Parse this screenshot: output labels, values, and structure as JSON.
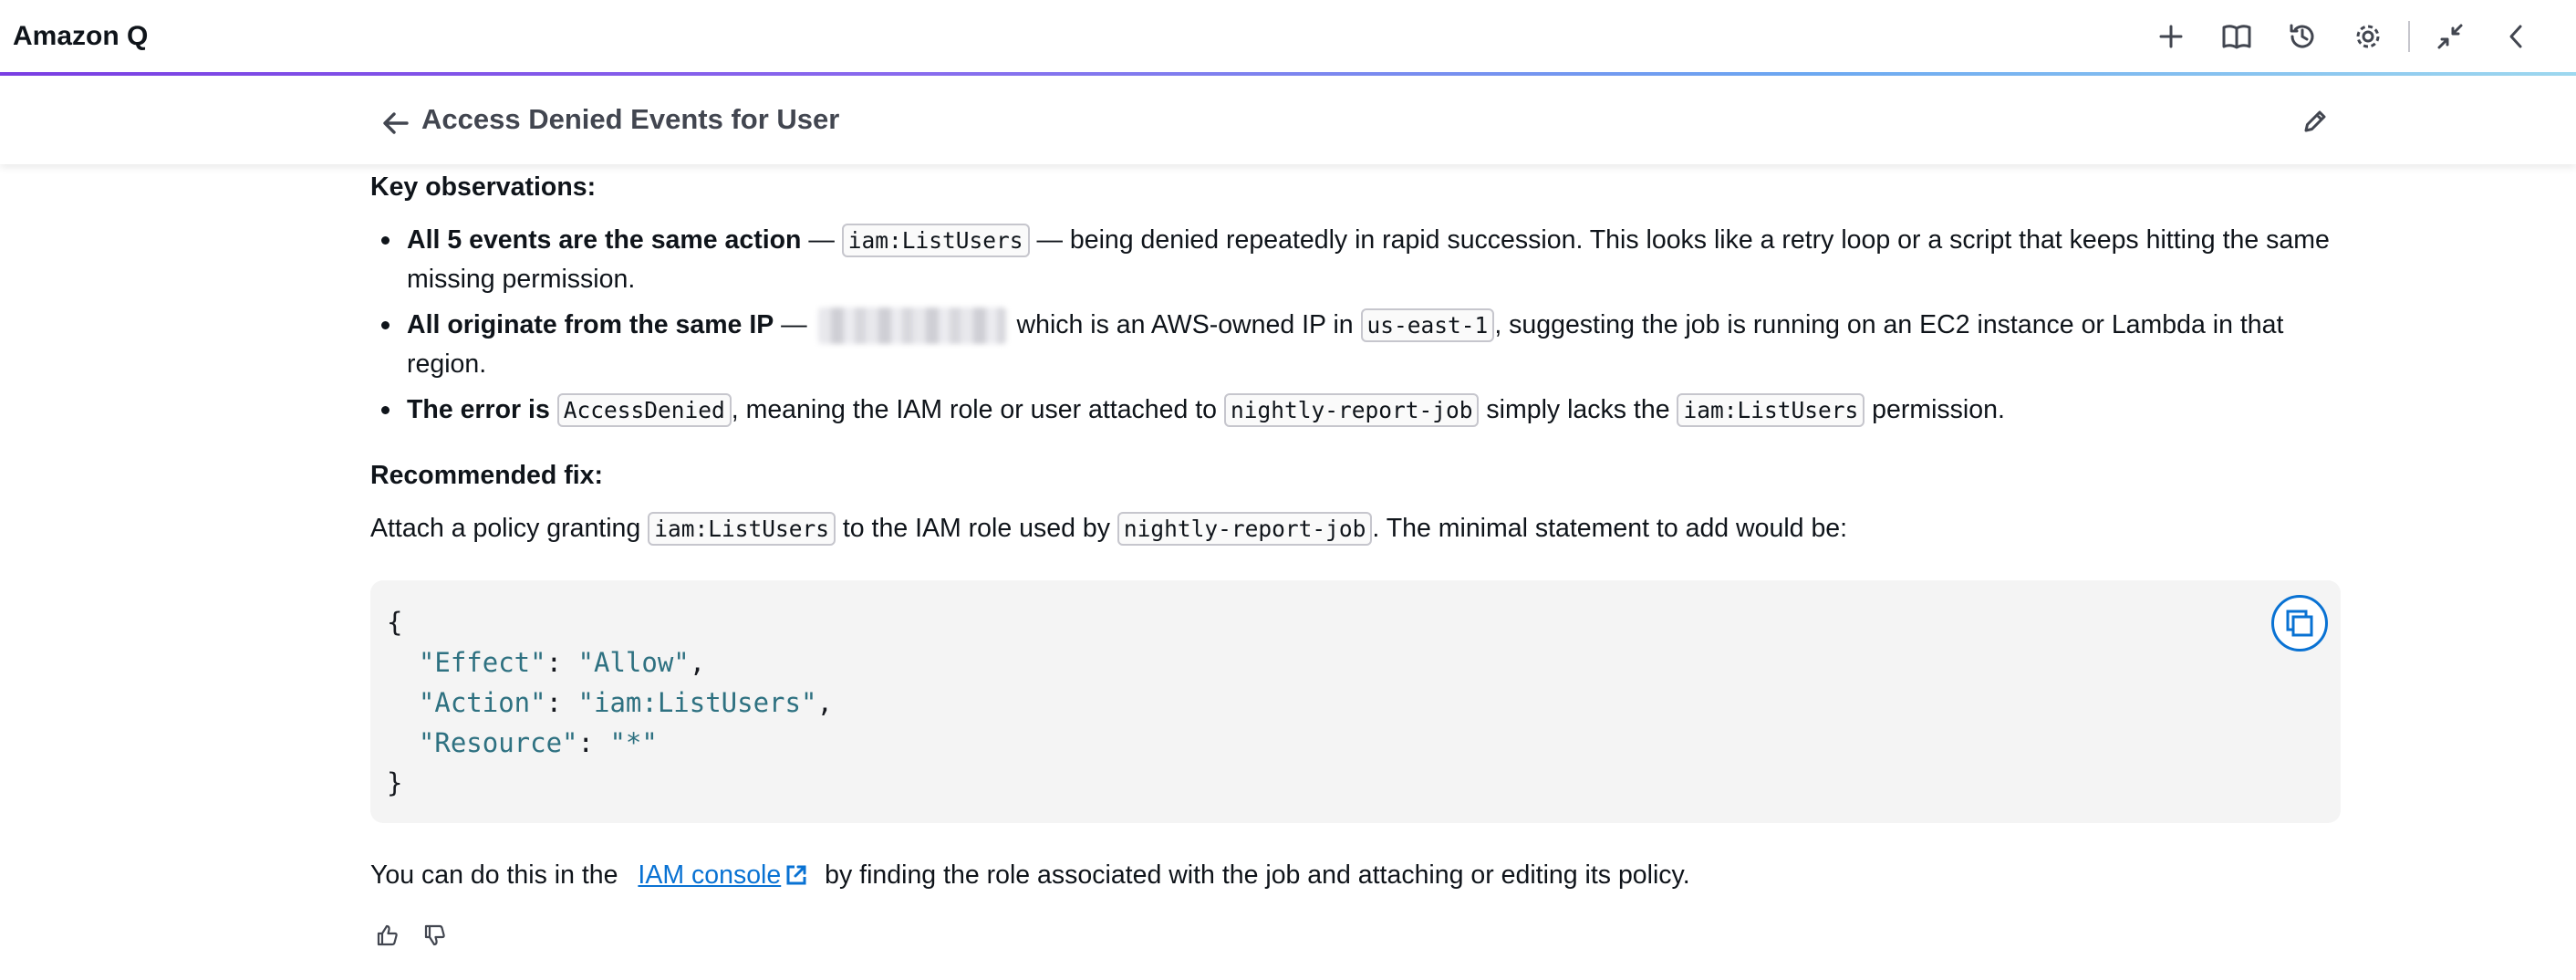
{
  "app": {
    "title": "Amazon Q"
  },
  "toolbar": {
    "icons": [
      "plus-icon",
      "book-icon",
      "history-icon",
      "gear-icon",
      "minimize-icon",
      "chevron-left-icon"
    ]
  },
  "conversation": {
    "title": "Access Denied Events for User"
  },
  "message": {
    "key_observations_heading": "Key observations:",
    "bullets": [
      {
        "bold": "All 5 events are the same action",
        "dash": " — ",
        "code1": "iam:ListUsers",
        "text": " — being denied repeatedly in rapid succession. This looks like a retry loop or a script that keeps hitting the same missing permission."
      },
      {
        "bold": "All originate from the same IP",
        "dash": " — ",
        "text1": " which is an AWS-owned IP in ",
        "code1": "us-east-1",
        "text2": ", suggesting the job is running on an EC2 instance or Lambda in that region."
      },
      {
        "bold": "The error is",
        "code1": "AccessDenied",
        "text1": ", meaning the IAM role or user attached to ",
        "code2": "nightly-report-job",
        "text2": " simply lacks the ",
        "code3": "iam:ListUsers",
        "text3": " permission."
      }
    ],
    "recommended_fix_heading": "Recommended fix:",
    "fix_paragraph": {
      "t1": "Attach a policy granting ",
      "code1": "iam:ListUsers",
      "t2": " to the IAM role used by ",
      "code2": "nightly-report-job",
      "t3": ". The minimal statement to add would be:"
    },
    "code_block": {
      "open": "{",
      "lines": [
        {
          "key": "\"Effect\"",
          "value": "\"Allow\"",
          "trail": ","
        },
        {
          "key": "\"Action\"",
          "value": "\"iam:ListUsers\"",
          "trail": ","
        },
        {
          "key": "\"Resource\"",
          "value": "\"*\"",
          "trail": ""
        }
      ],
      "close": "}"
    },
    "closing": {
      "t1": "You can do this in the ",
      "link": "IAM console",
      "t2": " by finding the role associated with the job and attaching or editing its policy."
    }
  },
  "colors": {
    "accent": "#0972d3",
    "code_string": "#2e7181",
    "gradient_start": "#7b3fe4",
    "gradient_end": "#9fd9f0"
  }
}
